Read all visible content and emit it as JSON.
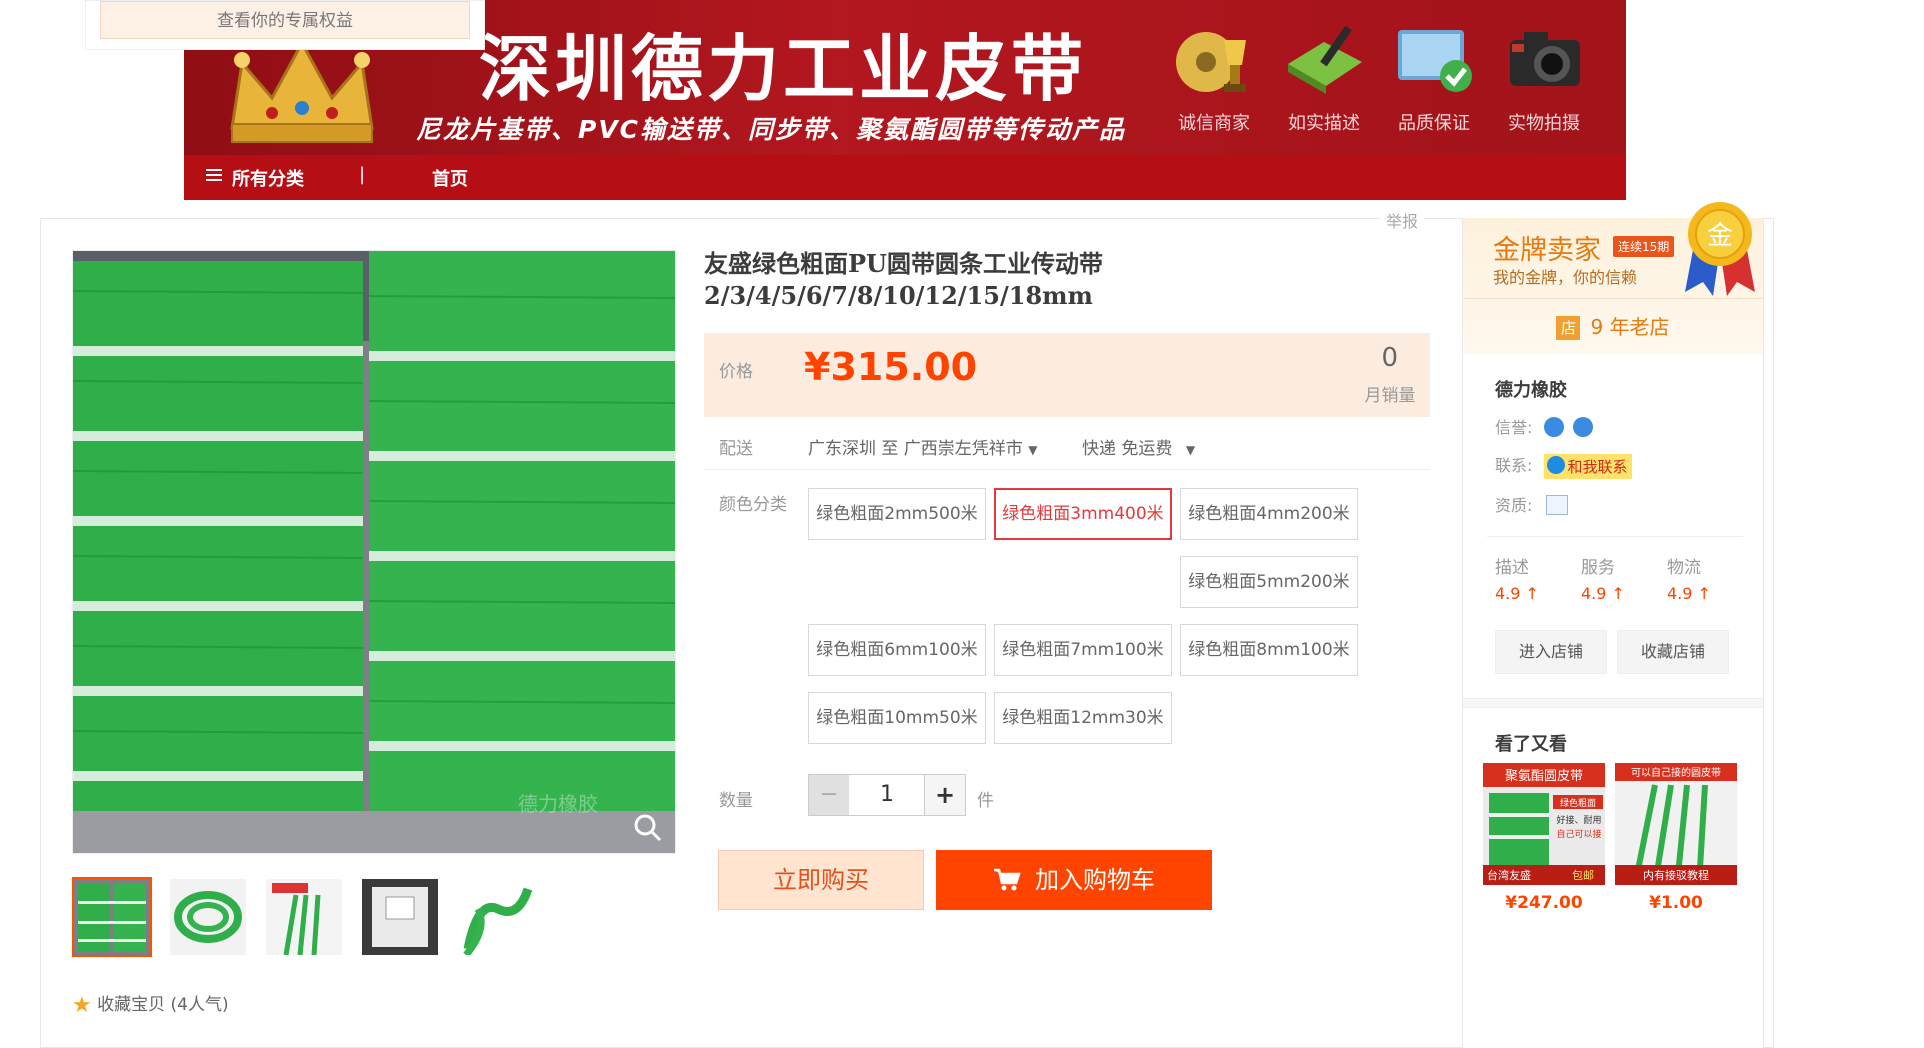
{
  "promo": {
    "text": "查看你的专属权益"
  },
  "banner": {
    "title": "深圳德力工业皮带",
    "subtitle": "尼龙片基带、PVC输送带、同步带、聚氨酯圆带等传动产品",
    "badges": [
      "诚信商家",
      "如实描述",
      "品质保证",
      "实物拍摄"
    ],
    "nav": {
      "menu": "所有分类",
      "separator": "|",
      "home": "首页"
    },
    "colors": {
      "brand_red": "#9c1218",
      "nav_red": "#b50e15"
    }
  },
  "report_link": "举报",
  "product": {
    "title": "友盛绿色粗面PU圆带圆条工业传动带2/3/4/5/6/7/8/10/12/15/18mm",
    "image_watermark": "德力橡胶",
    "price_label": "价格",
    "price": "¥315.00",
    "sales_count": "0",
    "sales_label": "月销量",
    "shipping": {
      "label": "配送",
      "from_to": "广东深圳 至 广西崇左凭祥市",
      "mode": "快递 免运费"
    },
    "color_label": "颜色分类",
    "options": [
      {
        "label": "绿色粗面2mm500米",
        "selected": false
      },
      {
        "label": "绿色粗面3mm400米",
        "selected": true
      },
      {
        "label": "绿色粗面4mm200米",
        "selected": false
      },
      {
        "label": "绿色粗面5mm200米",
        "selected": false
      },
      {
        "label": "绿色粗面6mm100米",
        "selected": false
      },
      {
        "label": "绿色粗面7mm100米",
        "selected": false
      },
      {
        "label": "绿色粗面8mm100米",
        "selected": false
      },
      {
        "label": "绿色粗面10mm50米",
        "selected": false
      },
      {
        "label": "绿色粗面12mm30米",
        "selected": false
      }
    ],
    "quantity": {
      "label": "数量",
      "minus": "−",
      "value": "1",
      "plus": "+",
      "unit": "件"
    },
    "buy_now": "立即购买",
    "add_to_cart": "加入购物车",
    "favorite": "收藏宝贝 (4人气)",
    "colors": {
      "accent": "#ff4400",
      "selected_border": "#e4393c",
      "price_bg": "#fcece0"
    }
  },
  "seller": {
    "gold_title": "金牌卖家",
    "gold_tag": "连续15期",
    "gold_sub": "我的金牌，你的信赖",
    "medal_text": "金",
    "shop_age": "9 年老店",
    "store_icon": "店",
    "shop_name": "德力橡胶",
    "credit_label": "信誉:",
    "contact_label": "联系:",
    "contact_button": "和我联系",
    "qualification_label": "资质:",
    "scores": [
      {
        "label": "描述",
        "value": "4.9 ↑"
      },
      {
        "label": "服务",
        "value": "4.9 ↑"
      },
      {
        "label": "物流",
        "value": "4.9 ↑"
      }
    ],
    "enter_shop": "进入店铺",
    "favorite_shop": "收藏店铺",
    "seen_title": "看了又看",
    "recommendations": [
      {
        "price": "¥247.00",
        "banner": "聚氨酯圆皮带",
        "tag1": "绿色粗面",
        "tag2": "好接、耐用",
        "tag3": "自己可以接",
        "bottom_left": "台湾友盛",
        "bottom_right": "包邮"
      },
      {
        "price": "¥1.00",
        "banner": "可以自己接的圆皮带",
        "bottom_left": "内有接驳教程"
      }
    ]
  }
}
